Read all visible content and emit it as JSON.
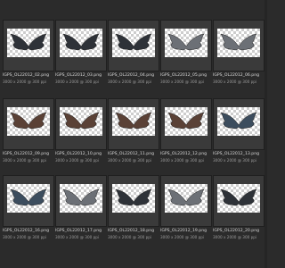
{
  "files": [
    {
      "row": 0,
      "col": 0,
      "name": "IGPS_OL22012_02.png",
      "meta": "3000 x 2000 @ 300 ppi",
      "wing": "dark"
    },
    {
      "row": 0,
      "col": 1,
      "name": "IGPS_OL22012_03.png",
      "meta": "3000 x 2000 @ 300 ppi",
      "wing": "dark"
    },
    {
      "row": 0,
      "col": 2,
      "name": "IGPS_OL22012_04.png",
      "meta": "3000 x 2000 @ 300 ppi",
      "wing": "dark"
    },
    {
      "row": 0,
      "col": 3,
      "name": "IGPS_OL22012_05.png",
      "meta": "3000 x 2000 @ 300 ppi",
      "wing": "grey"
    },
    {
      "row": 0,
      "col": 4,
      "name": "IGPS_OL22012_06.png",
      "meta": "3000 x 2000 @ 300 ppi",
      "wing": "grey"
    },
    {
      "row": 1,
      "col": 0,
      "name": "IGPS_OL22012_09.png",
      "meta": "3000 x 2000 @ 300 ppi",
      "wing": "brown"
    },
    {
      "row": 1,
      "col": 1,
      "name": "IGPS_OL22012_10.png",
      "meta": "3000 x 2000 @ 300 ppi",
      "wing": "brown"
    },
    {
      "row": 1,
      "col": 2,
      "name": "IGPS_OL22012_11.png",
      "meta": "3000 x 2000 @ 300 ppi",
      "wing": "brown"
    },
    {
      "row": 1,
      "col": 3,
      "name": "IGPS_OL22012_12.png",
      "meta": "3000 x 2000 @ 300 ppi",
      "wing": "brown"
    },
    {
      "row": 1,
      "col": 4,
      "name": "IGPS_OL22012_13.png",
      "meta": "3000 x 2000 @ 300 ppi",
      "wing": "blue"
    },
    {
      "row": 2,
      "col": 0,
      "name": "IGPS_OL22012_16.png",
      "meta": "3000 x 2000 @ 300 ppi",
      "wing": "blue"
    },
    {
      "row": 2,
      "col": 1,
      "name": "IGPS_OL22012_17.png",
      "meta": "3000 x 2000 @ 300 ppi",
      "wing": "grey"
    },
    {
      "row": 2,
      "col": 2,
      "name": "IGPS_OL22012_18.png",
      "meta": "3000 x 2000 @ 300 ppi",
      "wing": "dark"
    },
    {
      "row": 2,
      "col": 3,
      "name": "IGPS_OL22012_19.png",
      "meta": "3000 x 2000 @ 300 ppi",
      "wing": "grey"
    },
    {
      "row": 2,
      "col": 4,
      "name": "IGPS_OL22012_20.png",
      "meta": "3000 x 2000 @ 300 ppi",
      "wing": "dark"
    }
  ],
  "colors": {
    "background": "#2b2b2b",
    "wing_dark": "#2e3238",
    "wing_grey": "#6c7076",
    "wing_brown": "#5a4136",
    "wing_blue": "#3c4d5e"
  }
}
